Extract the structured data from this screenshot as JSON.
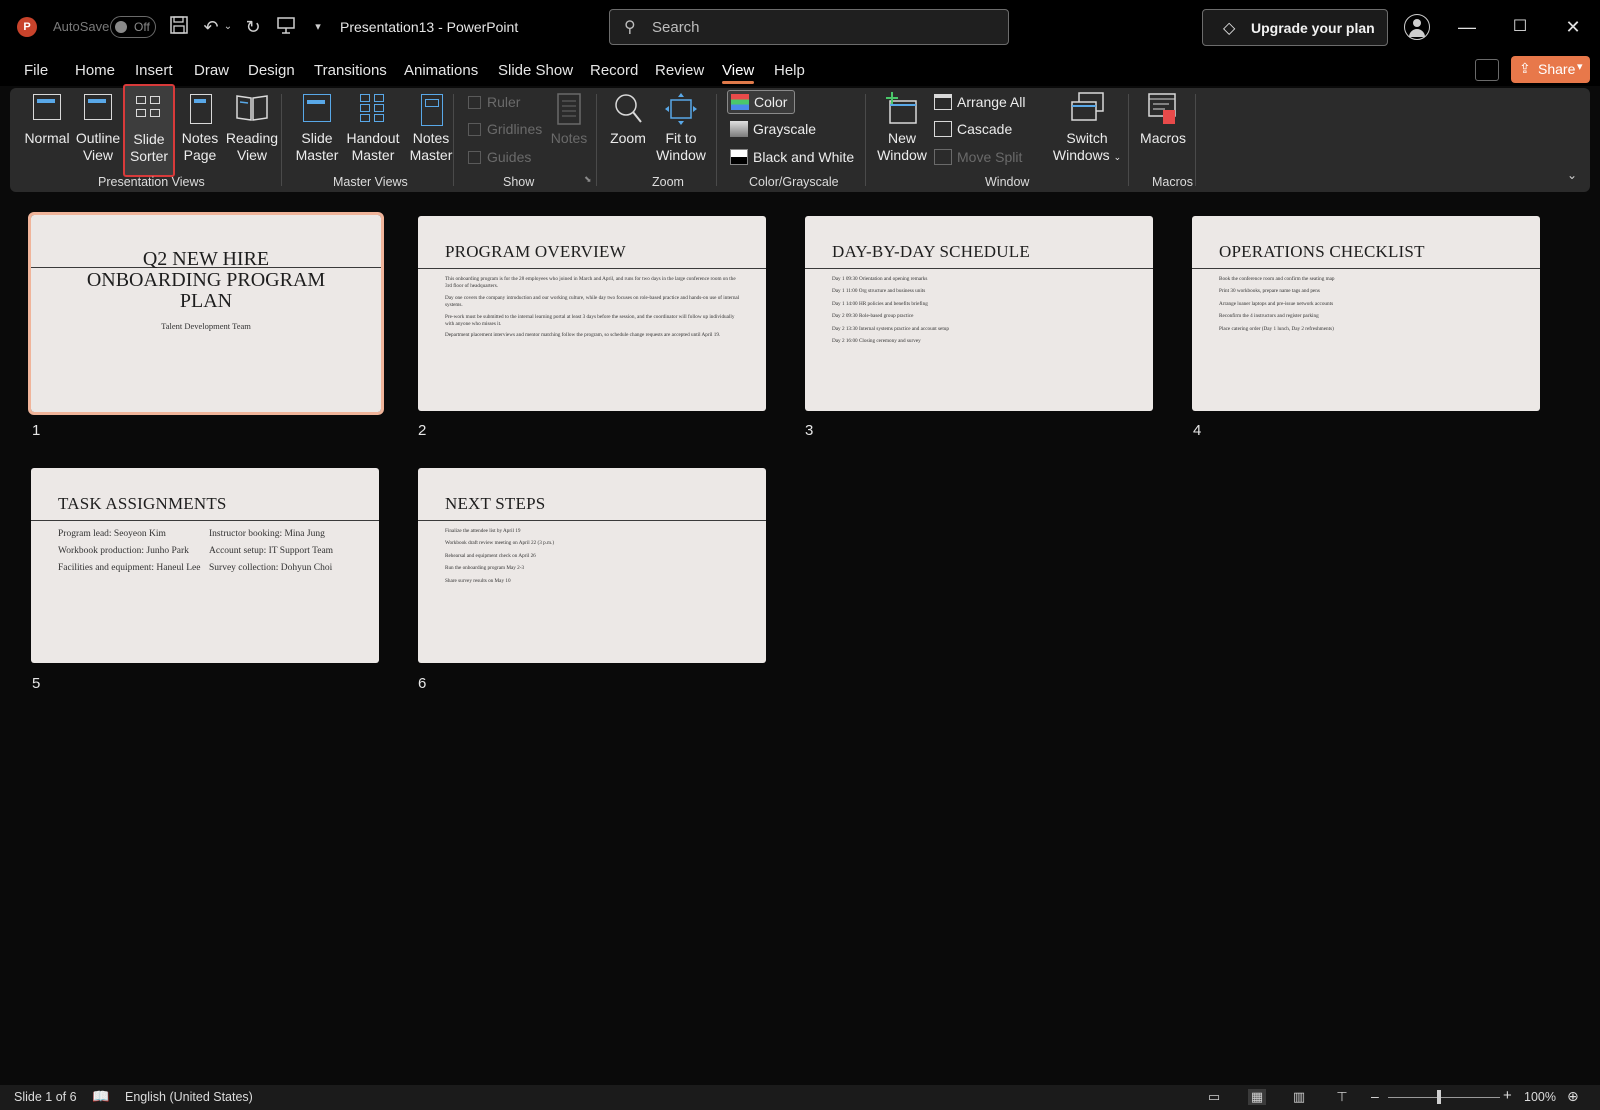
{
  "titlebar": {
    "autosave_label": "AutoSave",
    "autosave_state": "Off",
    "doc_title": "Presentation13  -  PowerPoint",
    "search_placeholder": "Search",
    "upgrade_label": "Upgrade your plan"
  },
  "menu": {
    "tabs": [
      "File",
      "Home",
      "Insert",
      "Draw",
      "Design",
      "Transitions",
      "Animations",
      "Slide Show",
      "Record",
      "Review",
      "View",
      "Help"
    ],
    "active_tab": "View",
    "share_label": "Share"
  },
  "ribbon": {
    "presentation_views": {
      "group_label": "Presentation Views",
      "normal": "Normal",
      "outline_view_1": "Outline",
      "outline_view_2": "View",
      "slide_sorter_1": "Slide",
      "slide_sorter_2": "Sorter",
      "notes_page_1": "Notes",
      "notes_page_2": "Page",
      "reading_view_1": "Reading",
      "reading_view_2": "View"
    },
    "master_views": {
      "group_label": "Master Views",
      "slide_master_1": "Slide",
      "slide_master_2": "Master",
      "handout_master_1": "Handout",
      "handout_master_2": "Master",
      "notes_master_1": "Notes",
      "notes_master_2": "Master"
    },
    "show": {
      "group_label": "Show",
      "ruler": "Ruler",
      "gridlines": "Gridlines",
      "guides": "Guides",
      "notes": "Notes"
    },
    "zoom": {
      "group_label": "Zoom",
      "zoom": "Zoom",
      "fit_to_window_1": "Fit to",
      "fit_to_window_2": "Window"
    },
    "color_grayscale": {
      "group_label": "Color/Grayscale",
      "color": "Color",
      "grayscale": "Grayscale",
      "black_and_white": "Black and White"
    },
    "window": {
      "group_label": "Window",
      "new_window_1": "New",
      "new_window_2": "Window",
      "arrange_all": "Arrange All",
      "cascade": "Cascade",
      "move_split": "Move Split",
      "switch_windows_1": "Switch",
      "switch_windows_2": "Windows"
    },
    "macros": {
      "group_label": "Macros",
      "macros": "Macros"
    }
  },
  "slides": [
    {
      "number": "1",
      "title_line1": "Q2 NEW HIRE",
      "title_line2": "ONBOARDING PROGRAM",
      "title_line3": "PLAN",
      "subtitle": "Talent Development Team"
    },
    {
      "number": "2",
      "title": "PROGRAM OVERVIEW",
      "paragraphs": [
        "This onboarding program is for the 28 employees who joined in March and April, and runs for two days in the large conference room on the 3rd floor of headquarters.",
        "Day one covers the company introduction and our working culture, while day two focuses on role-based practice and hands-on use of internal systems.",
        "Pre-work must be submitted to the internal learning portal at least 3 days before the session, and the coordinator will follow up individually with anyone who misses it.",
        "Department placement interviews and mentor matching follow the program, so schedule change requests are accepted until April 19."
      ]
    },
    {
      "number": "3",
      "title": "DAY-BY-DAY SCHEDULE",
      "items": [
        "Day 1 09:30 Orientation and opening remarks",
        "Day 1 11:00 Org structure and business units",
        "Day 1 14:00 HR policies and benefits briefing",
        "Day 2 09:30 Role-based group practice",
        "Day 2 13:30 Internal systems practice and account setup",
        "Day 2 16:00 Closing ceremony and survey"
      ]
    },
    {
      "number": "4",
      "title": "OPERATIONS CHECKLIST",
      "items": [
        "Book the conference room and confirm the seating map",
        "Print 30 workbooks, prepare name tags and pens",
        "Arrange loaner laptops and pre-issue network accounts",
        "Reconfirm the 4 instructors and register parking",
        "Place catering order (Day 1 lunch, Day 2 refreshments)"
      ]
    },
    {
      "number": "5",
      "title": "TASK ASSIGNMENTS",
      "left": [
        "Program lead: Seoyeon Kim",
        "Workbook production: Junho Park",
        "Facilities and equipment: Haneul Lee"
      ],
      "right": [
        "Instructor booking: Mina Jung",
        "Account setup: IT Support Team",
        "Survey collection: Dohyun Choi"
      ]
    },
    {
      "number": "6",
      "title": "NEXT STEPS",
      "items": [
        "Finalize the attendee list by April 19",
        "Workbook draft review meeting on April 22 (3 p.m.)",
        "Rehearsal and equipment check on April 26",
        "Run the onboarding program May 2-3",
        "Share survey results on May 10"
      ]
    }
  ],
  "status": {
    "slide_count": "Slide 1 of 6",
    "language": "English (United States)",
    "zoom_minus": "–",
    "zoom_plus": "+",
    "zoom_level": "100%"
  }
}
